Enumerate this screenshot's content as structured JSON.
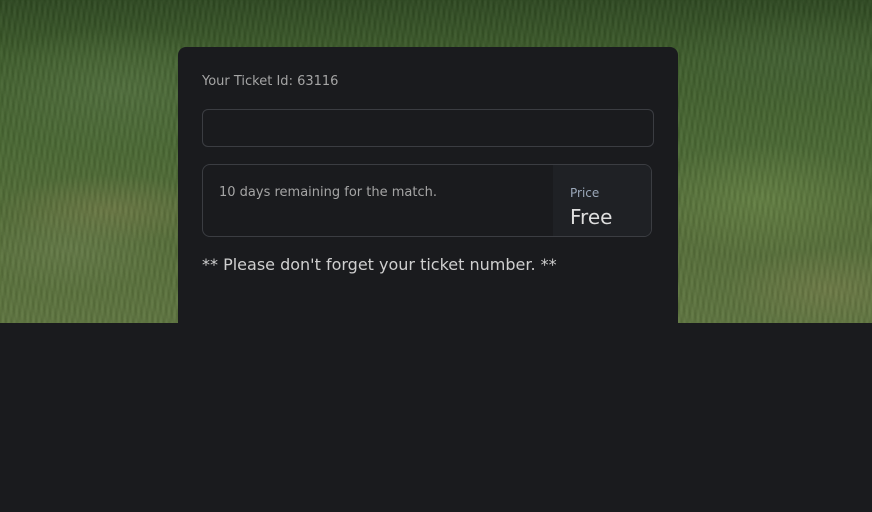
{
  "ticket": {
    "id_label": "Your Ticket Id: 63116",
    "input_value": "",
    "input_placeholder": ""
  },
  "match_info": {
    "remaining_text": "10 days remaining for the match.",
    "price_label": "Price",
    "price_value": "Free"
  },
  "reminder": "** Please don't forget your ticket number. **",
  "colors": {
    "page_background": "#1a1b1e",
    "card_background": "#1a1b1e",
    "border": "#3b3d42",
    "price_label": "#9aa7b8"
  }
}
